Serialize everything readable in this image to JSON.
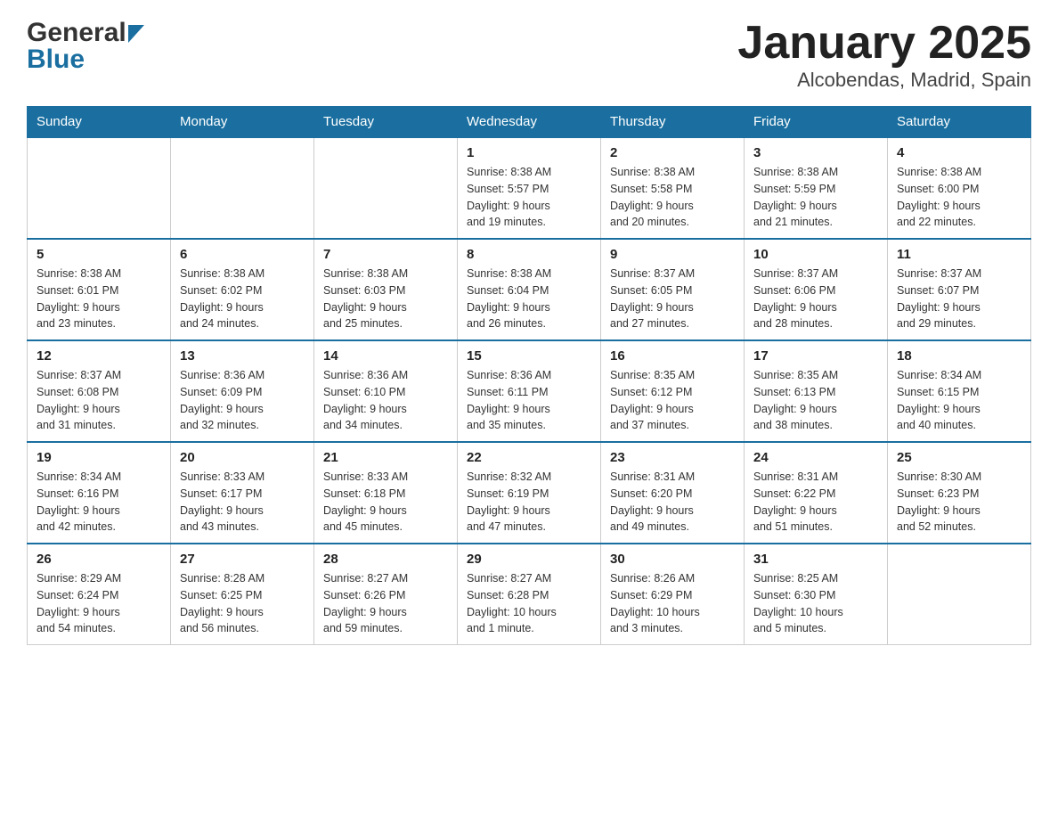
{
  "logo": {
    "general": "General",
    "blue": "Blue"
  },
  "title": "January 2025",
  "subtitle": "Alcobendas, Madrid, Spain",
  "days_of_week": [
    "Sunday",
    "Monday",
    "Tuesday",
    "Wednesday",
    "Thursday",
    "Friday",
    "Saturday"
  ],
  "weeks": [
    [
      {
        "day": "",
        "info": ""
      },
      {
        "day": "",
        "info": ""
      },
      {
        "day": "",
        "info": ""
      },
      {
        "day": "1",
        "info": "Sunrise: 8:38 AM\nSunset: 5:57 PM\nDaylight: 9 hours\nand 19 minutes."
      },
      {
        "day": "2",
        "info": "Sunrise: 8:38 AM\nSunset: 5:58 PM\nDaylight: 9 hours\nand 20 minutes."
      },
      {
        "day": "3",
        "info": "Sunrise: 8:38 AM\nSunset: 5:59 PM\nDaylight: 9 hours\nand 21 minutes."
      },
      {
        "day": "4",
        "info": "Sunrise: 8:38 AM\nSunset: 6:00 PM\nDaylight: 9 hours\nand 22 minutes."
      }
    ],
    [
      {
        "day": "5",
        "info": "Sunrise: 8:38 AM\nSunset: 6:01 PM\nDaylight: 9 hours\nand 23 minutes."
      },
      {
        "day": "6",
        "info": "Sunrise: 8:38 AM\nSunset: 6:02 PM\nDaylight: 9 hours\nand 24 minutes."
      },
      {
        "day": "7",
        "info": "Sunrise: 8:38 AM\nSunset: 6:03 PM\nDaylight: 9 hours\nand 25 minutes."
      },
      {
        "day": "8",
        "info": "Sunrise: 8:38 AM\nSunset: 6:04 PM\nDaylight: 9 hours\nand 26 minutes."
      },
      {
        "day": "9",
        "info": "Sunrise: 8:37 AM\nSunset: 6:05 PM\nDaylight: 9 hours\nand 27 minutes."
      },
      {
        "day": "10",
        "info": "Sunrise: 8:37 AM\nSunset: 6:06 PM\nDaylight: 9 hours\nand 28 minutes."
      },
      {
        "day": "11",
        "info": "Sunrise: 8:37 AM\nSunset: 6:07 PM\nDaylight: 9 hours\nand 29 minutes."
      }
    ],
    [
      {
        "day": "12",
        "info": "Sunrise: 8:37 AM\nSunset: 6:08 PM\nDaylight: 9 hours\nand 31 minutes."
      },
      {
        "day": "13",
        "info": "Sunrise: 8:36 AM\nSunset: 6:09 PM\nDaylight: 9 hours\nand 32 minutes."
      },
      {
        "day": "14",
        "info": "Sunrise: 8:36 AM\nSunset: 6:10 PM\nDaylight: 9 hours\nand 34 minutes."
      },
      {
        "day": "15",
        "info": "Sunrise: 8:36 AM\nSunset: 6:11 PM\nDaylight: 9 hours\nand 35 minutes."
      },
      {
        "day": "16",
        "info": "Sunrise: 8:35 AM\nSunset: 6:12 PM\nDaylight: 9 hours\nand 37 minutes."
      },
      {
        "day": "17",
        "info": "Sunrise: 8:35 AM\nSunset: 6:13 PM\nDaylight: 9 hours\nand 38 minutes."
      },
      {
        "day": "18",
        "info": "Sunrise: 8:34 AM\nSunset: 6:15 PM\nDaylight: 9 hours\nand 40 minutes."
      }
    ],
    [
      {
        "day": "19",
        "info": "Sunrise: 8:34 AM\nSunset: 6:16 PM\nDaylight: 9 hours\nand 42 minutes."
      },
      {
        "day": "20",
        "info": "Sunrise: 8:33 AM\nSunset: 6:17 PM\nDaylight: 9 hours\nand 43 minutes."
      },
      {
        "day": "21",
        "info": "Sunrise: 8:33 AM\nSunset: 6:18 PM\nDaylight: 9 hours\nand 45 minutes."
      },
      {
        "day": "22",
        "info": "Sunrise: 8:32 AM\nSunset: 6:19 PM\nDaylight: 9 hours\nand 47 minutes."
      },
      {
        "day": "23",
        "info": "Sunrise: 8:31 AM\nSunset: 6:20 PM\nDaylight: 9 hours\nand 49 minutes."
      },
      {
        "day": "24",
        "info": "Sunrise: 8:31 AM\nSunset: 6:22 PM\nDaylight: 9 hours\nand 51 minutes."
      },
      {
        "day": "25",
        "info": "Sunrise: 8:30 AM\nSunset: 6:23 PM\nDaylight: 9 hours\nand 52 minutes."
      }
    ],
    [
      {
        "day": "26",
        "info": "Sunrise: 8:29 AM\nSunset: 6:24 PM\nDaylight: 9 hours\nand 54 minutes."
      },
      {
        "day": "27",
        "info": "Sunrise: 8:28 AM\nSunset: 6:25 PM\nDaylight: 9 hours\nand 56 minutes."
      },
      {
        "day": "28",
        "info": "Sunrise: 8:27 AM\nSunset: 6:26 PM\nDaylight: 9 hours\nand 59 minutes."
      },
      {
        "day": "29",
        "info": "Sunrise: 8:27 AM\nSunset: 6:28 PM\nDaylight: 10 hours\nand 1 minute."
      },
      {
        "day": "30",
        "info": "Sunrise: 8:26 AM\nSunset: 6:29 PM\nDaylight: 10 hours\nand 3 minutes."
      },
      {
        "day": "31",
        "info": "Sunrise: 8:25 AM\nSunset: 6:30 PM\nDaylight: 10 hours\nand 5 minutes."
      },
      {
        "day": "",
        "info": ""
      }
    ]
  ]
}
